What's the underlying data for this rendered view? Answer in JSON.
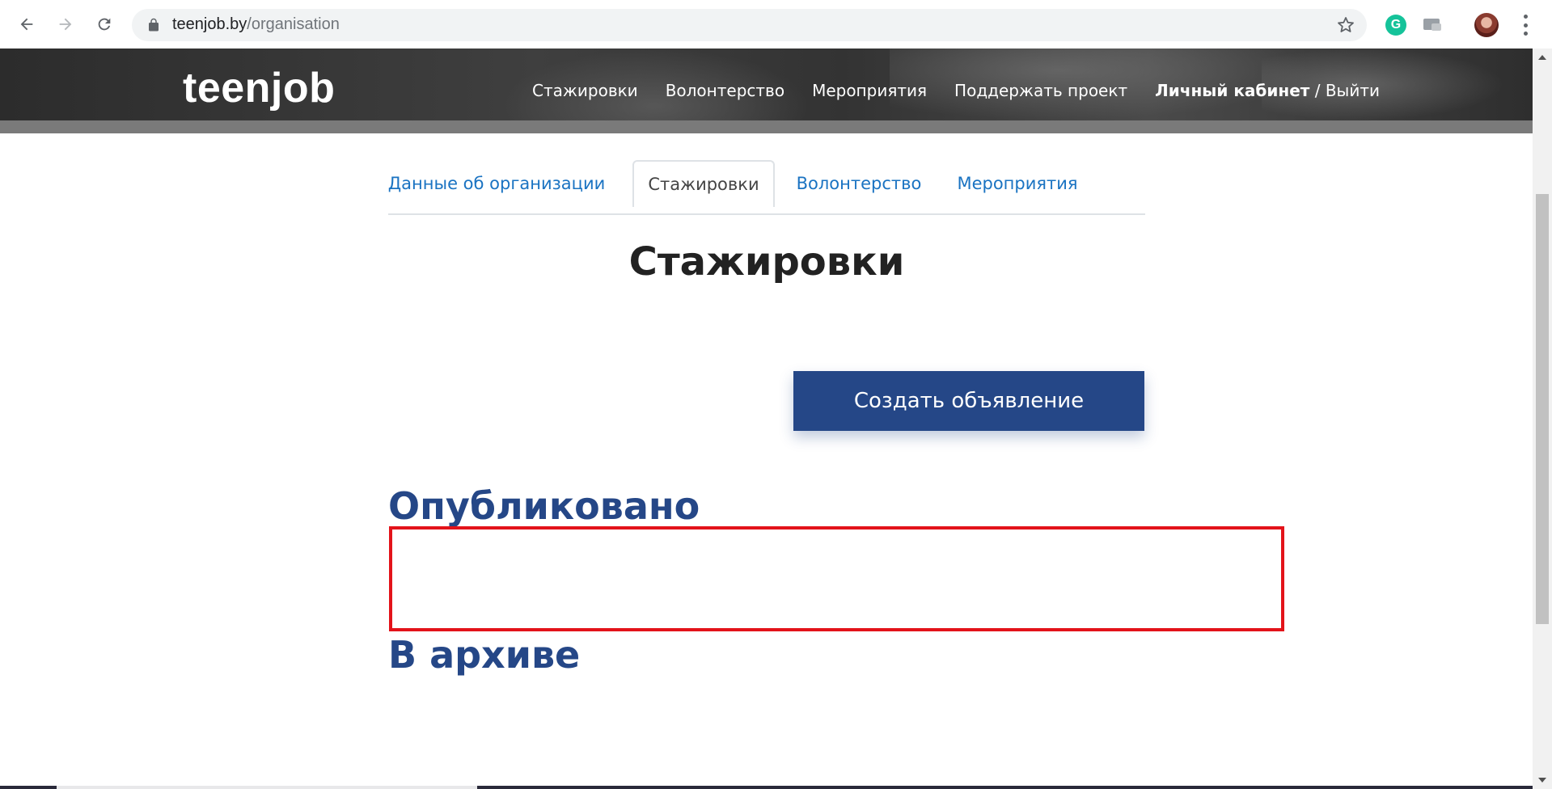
{
  "browser": {
    "url_host": "teenjob.by",
    "url_path": "/organisation"
  },
  "site": {
    "logo": "teenjob",
    "nav": {
      "internships": "Стажировки",
      "volunteering": "Волонтерство",
      "events": "Мероприятия",
      "support": "Поддержать проект",
      "account": "Личный кабинет",
      "separator": " / ",
      "logout": "Выйти"
    }
  },
  "tabs": {
    "org_data": "Данные об организации",
    "internships": "Стажировки",
    "volunteering": "Волонтерство",
    "events": "Мероприятия"
  },
  "main": {
    "title": "Стажировки",
    "create_button": "Создать объявление",
    "published_heading": "Опубликовано",
    "archived_heading": "В архиве"
  },
  "colors": {
    "primary": "#254787",
    "link": "#1a73c2",
    "highlight": "#e3131a"
  }
}
